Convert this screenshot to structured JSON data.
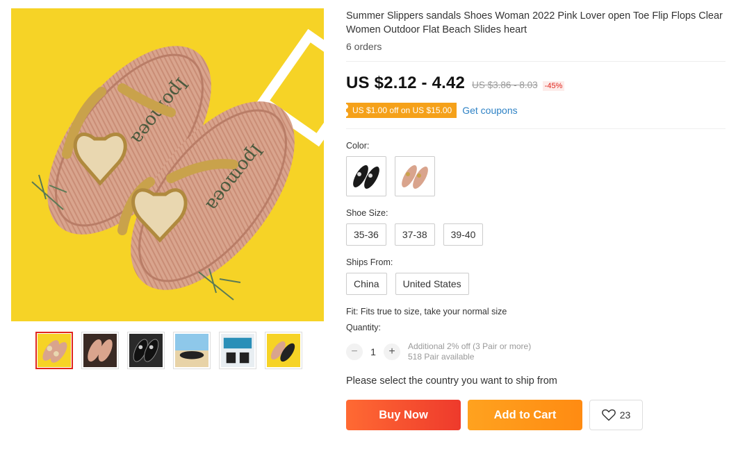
{
  "product": {
    "title": "Summer Slippers sandals Shoes Woman 2022 Pink Lover open Toe Flip Flops Clear Women Outdoor Flat Beach Slides heart",
    "orders": "6 orders",
    "price": "US $2.12 - 4.42",
    "old_price": "US $3.86 - 8.03",
    "discount": "-45%"
  },
  "coupon": {
    "tag": "US $1.00 off on US $15.00",
    "link": "Get coupons"
  },
  "gallery": {
    "main_image_icon": "slippers-photo",
    "thumbnails": [
      "thumb-gold",
      "thumb-dark",
      "thumb-black",
      "thumb-beach",
      "thumb-box",
      "thumb-yellow"
    ],
    "brand_text": "Ipomoea"
  },
  "color": {
    "label": "Color:",
    "options": [
      "black",
      "gold"
    ]
  },
  "size": {
    "label": "Shoe Size:",
    "options": [
      "35-36",
      "37-38",
      "39-40"
    ]
  },
  "ships_from": {
    "label": "Ships From:",
    "options": [
      "China",
      "United States"
    ]
  },
  "fit": "Fit: Fits true to size, take your normal size",
  "quantity": {
    "label": "Quantity:",
    "minus": "−",
    "value": "1",
    "plus": "+",
    "info_line1": "Additional 2% off (3 Pair or more)",
    "info_line2": "518 Pair available"
  },
  "ship_note": "Please select the country you want to ship from",
  "actions": {
    "buy_now": "Buy Now",
    "add_to_cart": "Add to Cart",
    "wishlist_count": "23"
  },
  "colors": {
    "accent": "#ee3a2c",
    "cart": "#ff8b12",
    "coupon": "#f5a11a",
    "link": "#2e82c5"
  }
}
